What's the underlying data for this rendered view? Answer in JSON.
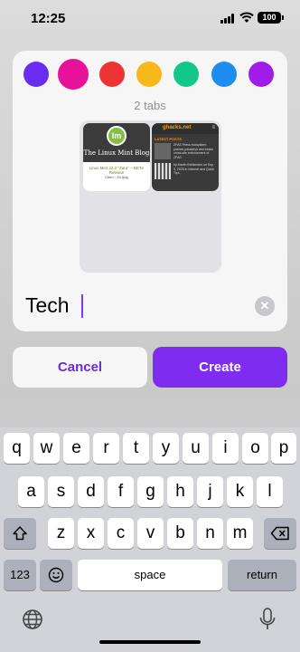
{
  "status": {
    "time": "12:25",
    "battery": "100"
  },
  "colors": {
    "swatches": [
      "#6a2cf0",
      "#e8129a",
      "#ee3333",
      "#f7b81a",
      "#12c78a",
      "#1f8df0",
      "#a11ce8"
    ],
    "selected": "#e8129a"
  },
  "group": {
    "tabs_count": "2 tabs",
    "name_value": "Tech"
  },
  "thumbs": {
    "mint": {
      "logo": "lm",
      "title": "The Linux Mint Blog",
      "headline": "Linux Mint 22.2 \"Zara\" – BETA Release",
      "meta": "Clem ◦ 24 Aug"
    },
    "ghacks": {
      "logo": "ghacks.net",
      "menu": "≡",
      "section": "LATEST POSTS",
      "post1": "ZFAS Press ecosystem pushes passkeys and tracks cross-site enforcement of ZFAS",
      "post2": "by Martin Brinkmann on Sep 3, 2025 in Internet and Quick Tips"
    }
  },
  "buttons": {
    "cancel": "Cancel",
    "create": "Create"
  },
  "keyboard": {
    "row1": [
      "q",
      "w",
      "e",
      "r",
      "t",
      "y",
      "u",
      "i",
      "o",
      "p"
    ],
    "row2": [
      "a",
      "s",
      "d",
      "f",
      "g",
      "h",
      "j",
      "k",
      "l"
    ],
    "row3": [
      "z",
      "x",
      "c",
      "v",
      "b",
      "n",
      "m"
    ],
    "numbers": "123",
    "space": "space",
    "return": "return"
  },
  "icons": {
    "shift": "shift-icon",
    "delete": "delete-icon",
    "emoji": "emoji-icon",
    "globe": "globe-icon",
    "mic": "microphone-icon",
    "clear": "clear-text-icon"
  }
}
